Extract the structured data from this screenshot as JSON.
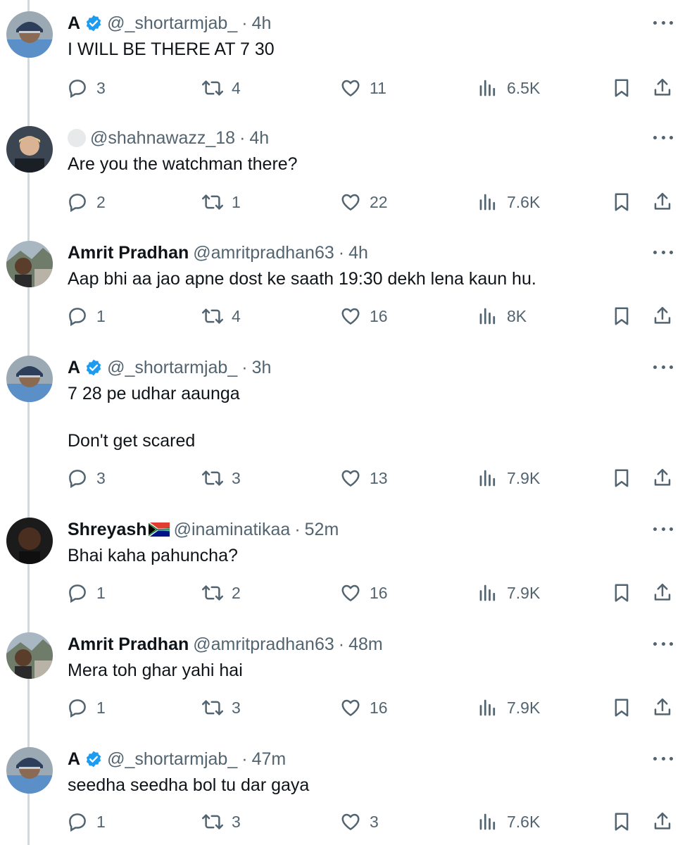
{
  "colors": {
    "text": "#0f1419",
    "muted": "#536471",
    "verified": "#1d9bf0",
    "thread_line": "#cfd9de"
  },
  "icons": [
    "reply-icon",
    "retweet-icon",
    "like-icon",
    "views-icon",
    "bookmark-icon",
    "share-icon",
    "more-icon",
    "verified-badge-icon"
  ],
  "tweets": [
    {
      "name": "A",
      "verified": true,
      "handle": "@_shortarmjab_",
      "sep": "·",
      "time": "4h",
      "lines": [
        "I WILL BE THERE AT 7 30"
      ],
      "replies": "3",
      "retweets": "4",
      "likes": "11",
      "views": "6.5K"
    },
    {
      "name": "",
      "verified": false,
      "handle": "@shahnawazz_18",
      "sep": "·",
      "time": "4h",
      "lines": [
        "Are you the watchman there?"
      ],
      "replies": "2",
      "retweets": "1",
      "likes": "22",
      "views": "7.6K"
    },
    {
      "name": "Amrit Pradhan",
      "verified": false,
      "handle": "@amritpradhan63",
      "sep": "·",
      "time": "4h",
      "lines": [
        "Aap bhi aa jao apne dost ke saath 19:30 dekh lena kaun hu."
      ],
      "replies": "1",
      "retweets": "4",
      "likes": "16",
      "views": "8K"
    },
    {
      "name": "A",
      "verified": true,
      "handle": "@_shortarmjab_",
      "sep": "·",
      "time": "3h",
      "lines": [
        "7 28 pe udhar aaunga",
        "",
        "Don't get scared"
      ],
      "replies": "3",
      "retweets": "3",
      "likes": "13",
      "views": "7.9K"
    },
    {
      "name": "Shreyash",
      "verified": false,
      "flag": true,
      "handle": "@inaminatikaa",
      "sep": "·",
      "time": "52m",
      "lines": [
        "Bhai kaha pahuncha?"
      ],
      "replies": "1",
      "retweets": "2",
      "likes": "16",
      "views": "7.9K"
    },
    {
      "name": "Amrit Pradhan",
      "verified": false,
      "handle": "@amritpradhan63",
      "sep": "·",
      "time": "48m",
      "lines": [
        "Mera toh ghar yahi hai"
      ],
      "replies": "1",
      "retweets": "3",
      "likes": "16",
      "views": "7.9K"
    },
    {
      "name": "A",
      "verified": true,
      "handle": "@_shortarmjab_",
      "sep": "·",
      "time": "47m",
      "lines": [
        "seedha seedha bol tu dar gaya"
      ],
      "replies": "1",
      "retweets": "3",
      "likes": "3",
      "views": "7.6K"
    }
  ]
}
